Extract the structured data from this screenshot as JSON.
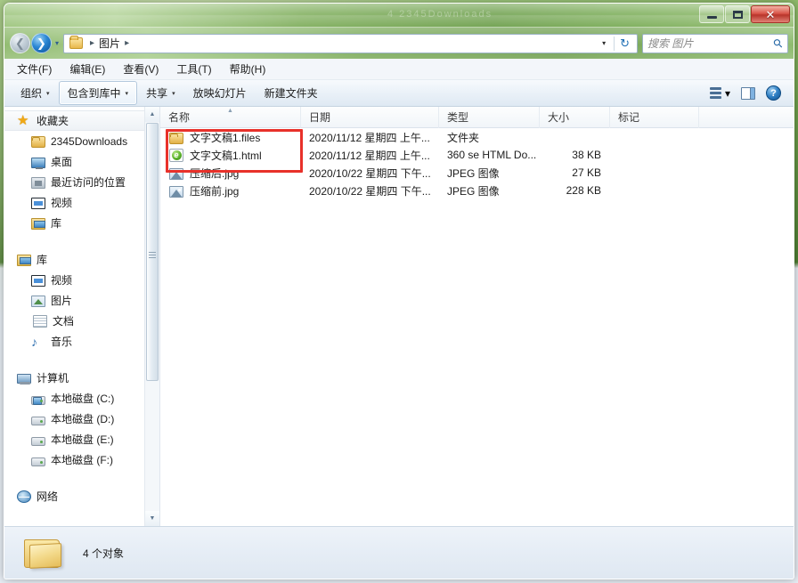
{
  "window": {
    "controls": {
      "minimize": "–",
      "maximize": "❐",
      "close": "✕"
    },
    "ghost_title": "4  2345Downloads    "
  },
  "address": {
    "back_label": "◀",
    "forward_label": "▶",
    "history_caret": "▾",
    "breadcrumb": {
      "folder_icon": "folder-icon",
      "current": "图片",
      "sep": "▸"
    },
    "dropdown_caret": "▾",
    "refresh_label": "↻"
  },
  "search": {
    "placeholder": "搜索 图片",
    "icon": "search-icon"
  },
  "menubar": {
    "items": [
      {
        "label": "文件(F)"
      },
      {
        "label": "编辑(E)"
      },
      {
        "label": "查看(V)"
      },
      {
        "label": "工具(T)"
      },
      {
        "label": "帮助(H)"
      }
    ]
  },
  "commandbar": {
    "organize": "组织",
    "include_in_library": "包含到库中",
    "share": "共享",
    "slideshow": "放映幻灯片",
    "new_folder": "新建文件夹",
    "caret": "▾",
    "view_icon": "view-options-icon",
    "view_caret": "▾",
    "preview_pane_icon": "preview-pane-icon",
    "help_icon": "?"
  },
  "sidebar": {
    "favorites": {
      "label": "收藏夹",
      "icon": "star-icon",
      "items": [
        {
          "label": "2345Downloads",
          "icon": "folder-icon"
        },
        {
          "label": "桌面",
          "icon": "desktop-icon"
        },
        {
          "label": "最近访问的位置",
          "icon": "recent-places-icon"
        },
        {
          "label": "视频",
          "icon": "video-icon"
        },
        {
          "label": "库",
          "icon": "library-icon"
        }
      ]
    },
    "libraries": {
      "label": "库",
      "icon": "library-icon",
      "items": [
        {
          "label": "视频",
          "icon": "video-icon"
        },
        {
          "label": "图片",
          "icon": "pictures-icon"
        },
        {
          "label": "文档",
          "icon": "documents-icon"
        },
        {
          "label": "音乐",
          "icon": "music-icon"
        }
      ]
    },
    "computer": {
      "label": "计算机",
      "icon": "computer-icon",
      "items": [
        {
          "label": "本地磁盘 (C:)",
          "icon": "system-drive-icon"
        },
        {
          "label": "本地磁盘 (D:)",
          "icon": "drive-icon"
        },
        {
          "label": "本地磁盘 (E:)",
          "icon": "drive-icon"
        },
        {
          "label": "本地磁盘 (F:)",
          "icon": "drive-icon"
        }
      ]
    },
    "network": {
      "label": "网络",
      "icon": "network-icon"
    },
    "scrollbar": {
      "up": "▲",
      "down": "▼"
    }
  },
  "filelist": {
    "columns": [
      {
        "key": "name",
        "label": "名称",
        "sorted": true,
        "sort_arrow": "▲"
      },
      {
        "key": "date",
        "label": "日期"
      },
      {
        "key": "type",
        "label": "类型"
      },
      {
        "key": "size",
        "label": "大小"
      },
      {
        "key": "tag",
        "label": "标记"
      }
    ],
    "rows": [
      {
        "icon": "folder-icon",
        "name": "文字文稿1.files",
        "date": "2020/11/12 星期四 上午...",
        "type": "文件夹",
        "size": "",
        "tag": ""
      },
      {
        "icon": "html-file-icon",
        "name": "文字文稿1.html",
        "date": "2020/11/12 星期四 上午...",
        "type": "360 se HTML Do...",
        "size": "38 KB",
        "tag": ""
      },
      {
        "icon": "jpeg-image-icon",
        "name": "压缩后.jpg",
        "date": "2020/10/22 星期四 下午...",
        "type": "JPEG 图像",
        "size": "27 KB",
        "tag": ""
      },
      {
        "icon": "jpeg-image-icon",
        "name": "压缩前.jpg",
        "date": "2020/10/22 星期四 下午...",
        "type": "JPEG 图像",
        "size": "228 KB",
        "tag": ""
      }
    ],
    "annotation": {
      "color": "#e8312a",
      "highlights_rows": [
        0,
        1
      ]
    }
  },
  "statusbar": {
    "folder_icon": "folder-icon",
    "item_count": "4 个对象"
  }
}
